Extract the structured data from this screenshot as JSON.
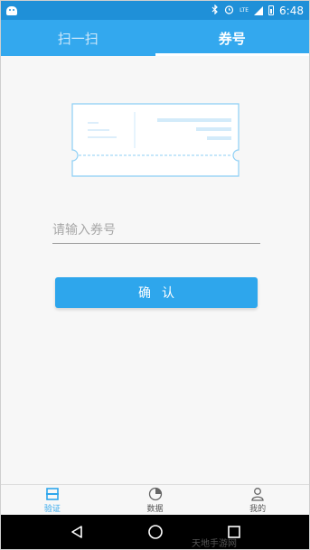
{
  "status_bar": {
    "time": "6:48",
    "icons": [
      "android-icon",
      "bluetooth-icon",
      "alarm-icon",
      "lte-icon",
      "signal-icon",
      "battery-icon"
    ],
    "lte_label": "LTE"
  },
  "tabs": [
    {
      "label": "扫一扫",
      "active": false
    },
    {
      "label": "券号",
      "active": true
    }
  ],
  "form": {
    "coupon_placeholder": "请输入券号",
    "coupon_value": "",
    "confirm_label": "确认"
  },
  "bottom_nav": [
    {
      "label": "验证",
      "icon": "verify-icon",
      "active": true
    },
    {
      "label": "数据",
      "icon": "pie-chart-icon",
      "active": false
    },
    {
      "label": "我的",
      "icon": "user-icon",
      "active": false
    }
  ],
  "system_nav": [
    "back-icon",
    "home-icon",
    "recents-icon"
  ],
  "watermark": "天地手游网",
  "colors": {
    "status_bar": "#1f90d8",
    "primary": "#33a8ee",
    "button": "#2ea6ec",
    "background": "#f7f7f7"
  }
}
